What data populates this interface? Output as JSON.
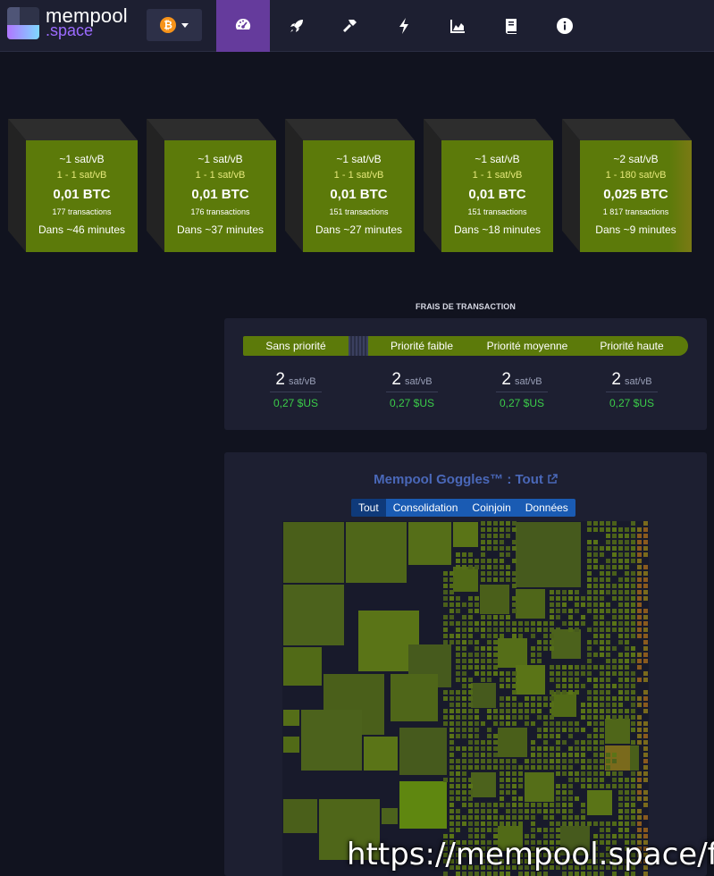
{
  "brand": {
    "name": "mempool",
    "suffix": ".space"
  },
  "network": {
    "symbol": "₿"
  },
  "nav": [
    {
      "icon": "dashboard-icon",
      "active": true
    },
    {
      "icon": "rocket-icon",
      "active": false
    },
    {
      "icon": "hammer-icon",
      "active": false
    },
    {
      "icon": "lightning-icon",
      "active": false
    },
    {
      "icon": "chart-area-icon",
      "active": false
    },
    {
      "icon": "book-icon",
      "active": false
    },
    {
      "icon": "info-icon",
      "active": false
    }
  ],
  "blocks": [
    {
      "fee": "~1 sat/vB",
      "range": "1 - 1 sat/vB",
      "size": "0,01 BTC",
      "txs": "177 transactions",
      "time": "Dans ~46 minutes"
    },
    {
      "fee": "~1 sat/vB",
      "range": "1 - 1 sat/vB",
      "size": "0,01 BTC",
      "txs": "176 transactions",
      "time": "Dans ~37 minutes"
    },
    {
      "fee": "~1 sat/vB",
      "range": "1 - 1 sat/vB",
      "size": "0,01 BTC",
      "txs": "151 transactions",
      "time": "Dans ~27 minutes"
    },
    {
      "fee": "~1 sat/vB",
      "range": "1 - 1 sat/vB",
      "size": "0,01 BTC",
      "txs": "151 transactions",
      "time": "Dans ~18 minutes"
    },
    {
      "fee": "~2 sat/vB",
      "range": "1 - 180 sat/vB",
      "size": "0,025 BTC",
      "txs": "1 817 transactions",
      "time": "Dans ~9 minutes"
    }
  ],
  "fees": {
    "title": "FRAIS DE TRANSACTION",
    "priorities": [
      "Sans priorité",
      "Priorité faible",
      "Priorité moyenne",
      "Priorité haute"
    ],
    "values": [
      {
        "num": "2",
        "unit": "sat/vB",
        "usd": "0,27 $US"
      },
      {
        "num": "2",
        "unit": "sat/vB",
        "usd": "0,27 $US"
      },
      {
        "num": "2",
        "unit": "sat/vB",
        "usd": "0,27 $US"
      },
      {
        "num": "2",
        "unit": "sat/vB",
        "usd": "0,27 $US"
      }
    ]
  },
  "goggles": {
    "title": "Mempool Goggles™ : Tout",
    "tabs": [
      "Tout",
      "Consolidation",
      "Coinjoin",
      "Données"
    ],
    "active_tab": "Tout"
  },
  "colors": {
    "block": "#5c7a0a",
    "accent": "#653b9c",
    "usd": "#3bcc49",
    "tab": "#1a5bb3"
  },
  "overlay_url": "https://mempool.space/fr/"
}
